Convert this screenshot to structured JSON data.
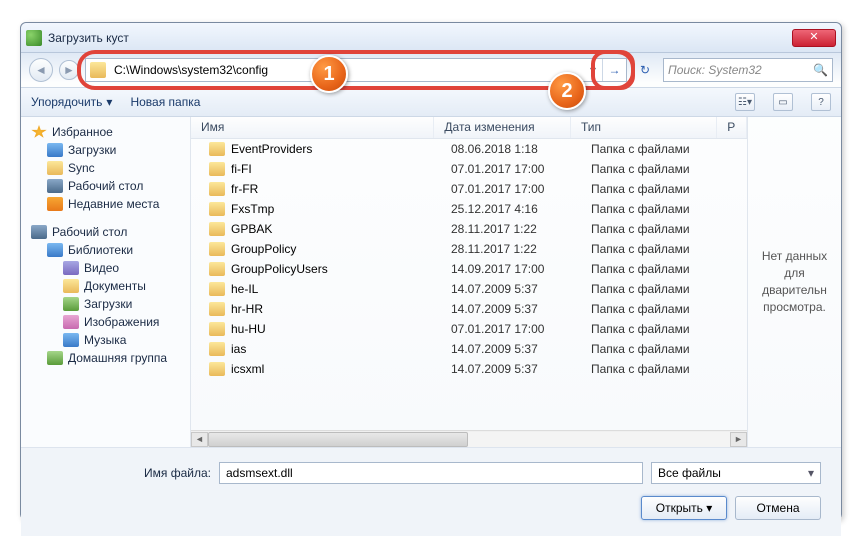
{
  "window": {
    "title": "Загрузить куст"
  },
  "nav": {
    "address": "C:\\Windows\\system32\\config",
    "search_placeholder": "Поиск: System32",
    "badge1": "1",
    "badge2": "2"
  },
  "toolbar": {
    "organize": "Упорядочить",
    "new_folder": "Новая папка"
  },
  "tree": {
    "favorites": "Избранное",
    "downloads": "Загрузки",
    "sync": "Sync",
    "desktop_fav": "Рабочий стол",
    "recent": "Недавние места",
    "desktop": "Рабочий стол",
    "libraries": "Библиотеки",
    "video": "Видео",
    "documents": "Документы",
    "downloads2": "Загрузки",
    "images": "Изображения",
    "music": "Музыка",
    "homegroup": "Домашняя группа"
  },
  "columns": {
    "name": "Имя",
    "date": "Дата изменения",
    "type": "Тип",
    "size": "Р"
  },
  "files": [
    {
      "name": "EventProviders",
      "date": "08.06.2018 1:18",
      "type": "Папка с файлами"
    },
    {
      "name": "fi-FI",
      "date": "07.01.2017 17:00",
      "type": "Папка с файлами"
    },
    {
      "name": "fr-FR",
      "date": "07.01.2017 17:00",
      "type": "Папка с файлами"
    },
    {
      "name": "FxsTmp",
      "date": "25.12.2017 4:16",
      "type": "Папка с файлами"
    },
    {
      "name": "GPBAK",
      "date": "28.11.2017 1:22",
      "type": "Папка с файлами"
    },
    {
      "name": "GroupPolicy",
      "date": "28.11.2017 1:22",
      "type": "Папка с файлами"
    },
    {
      "name": "GroupPolicyUsers",
      "date": "14.09.2017 17:00",
      "type": "Папка с файлами"
    },
    {
      "name": "he-IL",
      "date": "14.07.2009 5:37",
      "type": "Папка с файлами"
    },
    {
      "name": "hr-HR",
      "date": "14.07.2009 5:37",
      "type": "Папка с файлами"
    },
    {
      "name": "hu-HU",
      "date": "07.01.2017 17:00",
      "type": "Папка с файлами"
    },
    {
      "name": "ias",
      "date": "14.07.2009 5:37",
      "type": "Папка с файлами"
    },
    {
      "name": "icsxml",
      "date": "14.07.2009 5:37",
      "type": "Папка с файлами"
    }
  ],
  "preview": {
    "text": "Нет данных для дварительн просмотра."
  },
  "bottom": {
    "filename_label": "Имя файла:",
    "filename_value": "adsmsext.dll",
    "filter": "Все файлы",
    "open": "Открыть",
    "cancel": "Отмена"
  }
}
